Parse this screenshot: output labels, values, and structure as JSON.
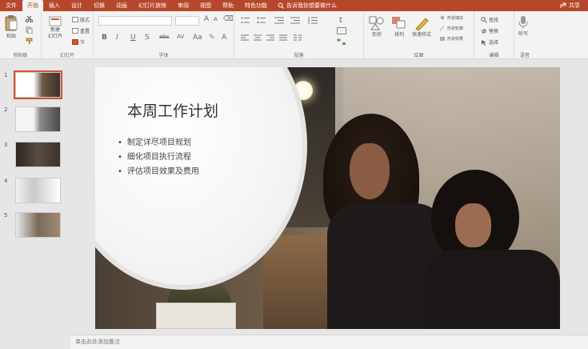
{
  "tabs": [
    "文件",
    "开始",
    "插入",
    "设计",
    "切换",
    "动画",
    "幻灯片放映",
    "审阅",
    "视图",
    "帮助",
    "特色功能"
  ],
  "active_tab_index": 1,
  "tell_me": "告诉我你想要做什么",
  "share": "共享",
  "ribbon": {
    "clipboard": {
      "label": "剪贴板",
      "paste": "粘贴"
    },
    "slides": {
      "label": "幻灯片",
      "new_slide": "新建\n幻灯片",
      "layout": "版式",
      "reset": "重置",
      "section": "节"
    },
    "font": {
      "label": "字体"
    },
    "paragraph": {
      "label": "段落"
    },
    "drawing": {
      "label": "绘图",
      "shapes": "形状",
      "arrange": "排列",
      "quick_styles": "快速样式",
      "fill": "形状填充",
      "outline": "形状轮廓",
      "effects": "形状效果"
    },
    "editing": {
      "label": "编辑",
      "find": "查找",
      "replace": "替换",
      "select": "选择"
    },
    "voice": {
      "label": "语音",
      "dictate": "听写"
    }
  },
  "slides": [
    {
      "number": "1",
      "selected": true
    },
    {
      "number": "2",
      "selected": false
    },
    {
      "number": "3",
      "selected": false
    },
    {
      "number": "4",
      "selected": false
    },
    {
      "number": "5",
      "selected": false
    }
  ],
  "current_slide": {
    "title": "本周工作计划",
    "bullets": [
      "制定详尽项目规划",
      "细化项目执行流程",
      "评估项目效果及费用"
    ]
  },
  "notes_placeholder": "单击此处添加备注",
  "colors": {
    "accent": "#b7472a",
    "selection": "#d35230"
  }
}
